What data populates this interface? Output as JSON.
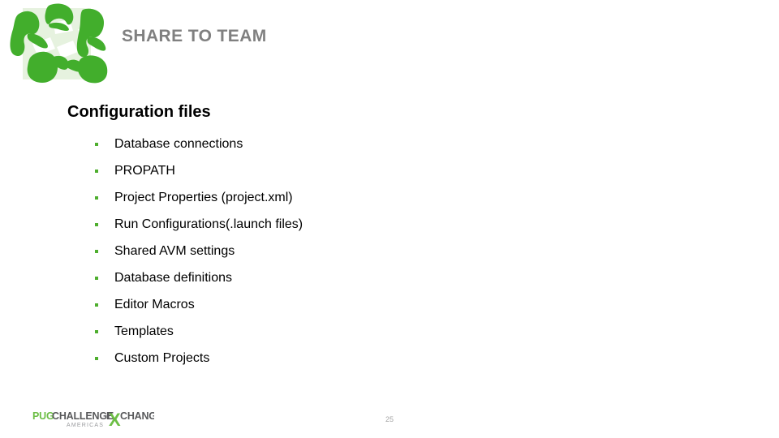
{
  "header": {
    "title": "SHARE TO TEAM",
    "title_color": "#808080",
    "logo_name": "team-collaboration-logo",
    "logo_green": "#42AE2C",
    "logo_pale_green": "#E6F2DF"
  },
  "content": {
    "section_heading": "Configuration files",
    "bullets": [
      {
        "label": "Database connections"
      },
      {
        "label": "PROPATH"
      },
      {
        "label": "Project Properties (project.xml)"
      },
      {
        "label": "Run Configurations(.launch files)"
      },
      {
        "label": "Shared AVM settings"
      },
      {
        "label": "Database definitions"
      },
      {
        "label": "Editor Macros"
      },
      {
        "label": "Templates"
      },
      {
        "label": "Custom Projects"
      }
    ],
    "bullet_color": "#4EAE2E"
  },
  "footer": {
    "brand_pug": "PUG",
    "brand_challenge": "CHALLENGE",
    "brand_e": "E",
    "brand_x": "X",
    "brand_change": "CHANGE",
    "brand_region": "AMERICAS",
    "brand_green": "#6CBE45",
    "brand_dark": "#58595B",
    "page_number": "25"
  }
}
